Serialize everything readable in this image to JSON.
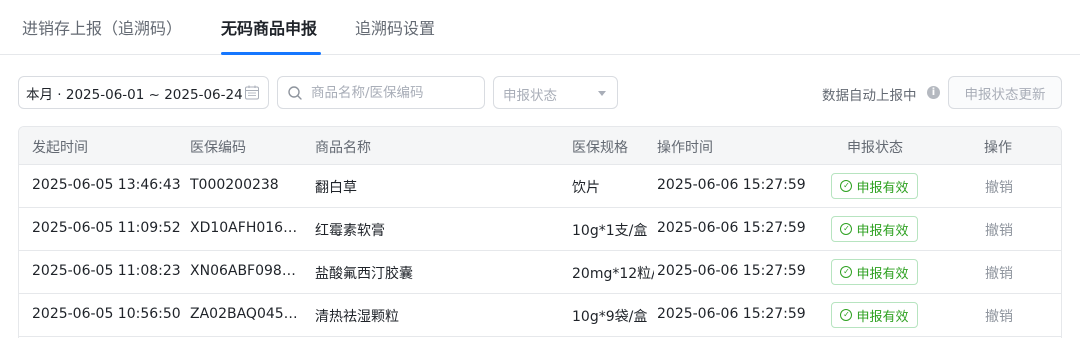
{
  "tabs": [
    {
      "label": "进销存上报（追溯码）",
      "active": false
    },
    {
      "label": "无码商品申报",
      "active": true
    },
    {
      "label": "追溯码设置",
      "active": false
    }
  ],
  "filters": {
    "date_range": "本月 · 2025-06-01 ~ 2025-06-24",
    "calendar_icon": "calendar-icon",
    "search_placeholder": "商品名称/医保编码",
    "search_icon": "search-icon",
    "status_placeholder": "申报状态",
    "auto_report_text": "数据自动上报中",
    "update_button": "申报状态更新"
  },
  "table": {
    "columns": [
      "发起时间",
      "医保编码",
      "商品名称",
      "医保规格",
      "操作时间",
      "申报状态",
      "操作"
    ],
    "rows": [
      {
        "start_time": "2025-06-05 13:46:43",
        "code": "T000200238",
        "name": "翻白草",
        "spec": "饮片",
        "op_time": "2025-06-06 15:27:59",
        "status": "申报有效",
        "action": "撤销"
      },
      {
        "start_time": "2025-06-05 11:09:52",
        "code": "XD10AFH016…",
        "name": "红霉素软膏",
        "spec": "10g*1支/盒",
        "op_time": "2025-06-06 15:27:59",
        "status": "申报有效",
        "action": "撤销"
      },
      {
        "start_time": "2025-06-05 11:08:23",
        "code": "XN06ABF098…",
        "name": "盐酸氟西汀胶囊",
        "spec": "20mg*12粒/",
        "op_time": "2025-06-06 15:27:59",
        "status": "申报有效",
        "action": "撤销"
      },
      {
        "start_time": "2025-06-05 10:56:50",
        "code": "ZA02BAQ045…",
        "name": "清热祛湿颗粒",
        "spec": "10g*9袋/盒",
        "op_time": "2025-06-06 15:27:59",
        "status": "申报有效",
        "action": "撤销"
      }
    ]
  },
  "colors": {
    "accent": "#1677ff",
    "status_valid": "#2ea121",
    "header_bg": "#f5f6f7"
  }
}
